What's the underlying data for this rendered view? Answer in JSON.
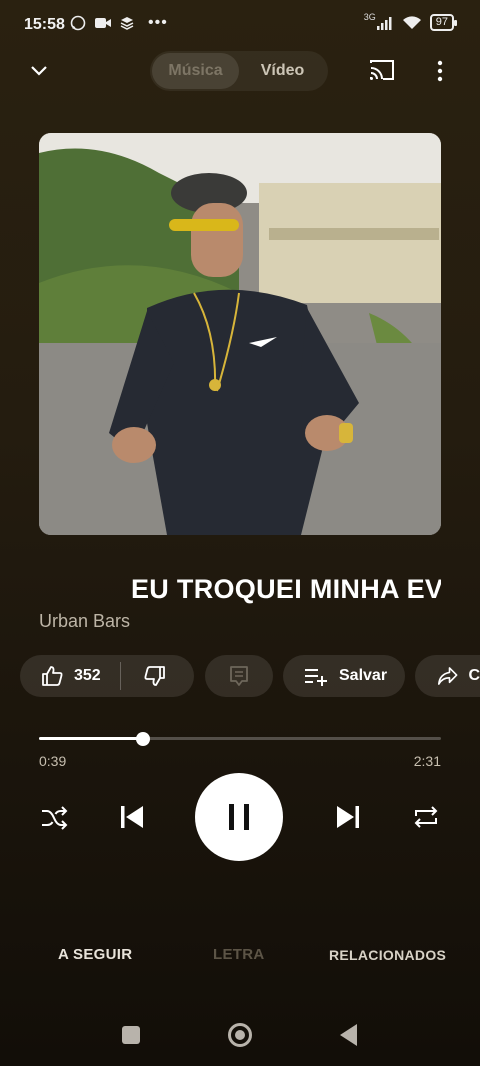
{
  "status_bar": {
    "time": "15:58",
    "network": "3G",
    "battery": "97"
  },
  "top_bar": {
    "tabs": [
      {
        "label": "Música"
      },
      {
        "label": "Vídeo"
      }
    ]
  },
  "track": {
    "title": "EU TROQUEI MINHA EV",
    "artist": "Urban Bars"
  },
  "actions": {
    "like_count": "352",
    "save_label": "Salvar",
    "share_label": "C"
  },
  "progress": {
    "current": "0:39",
    "total": "2:31",
    "fraction": 0.258
  },
  "bottom_tabs": [
    {
      "label": "A SEGUIR"
    },
    {
      "label": "LETRA"
    },
    {
      "label": "RELACIONADOS"
    }
  ],
  "colors": {
    "background": "#241c0f",
    "accent": "#ffffff",
    "disabled_text": "#5c5446"
  },
  "icons": [
    "whatsapp-icon",
    "video-camera-icon",
    "layers-icon",
    "more-dots-icon",
    "signal-icon",
    "wifi-icon",
    "battery-icon",
    "chevron-down-icon",
    "cast-icon",
    "more-vert-icon",
    "thumbs-up-icon",
    "thumbs-down-icon",
    "comment-icon",
    "playlist-add-icon",
    "share-icon",
    "shuffle-icon",
    "previous-icon",
    "pause-icon",
    "next-icon",
    "repeat-icon"
  ]
}
